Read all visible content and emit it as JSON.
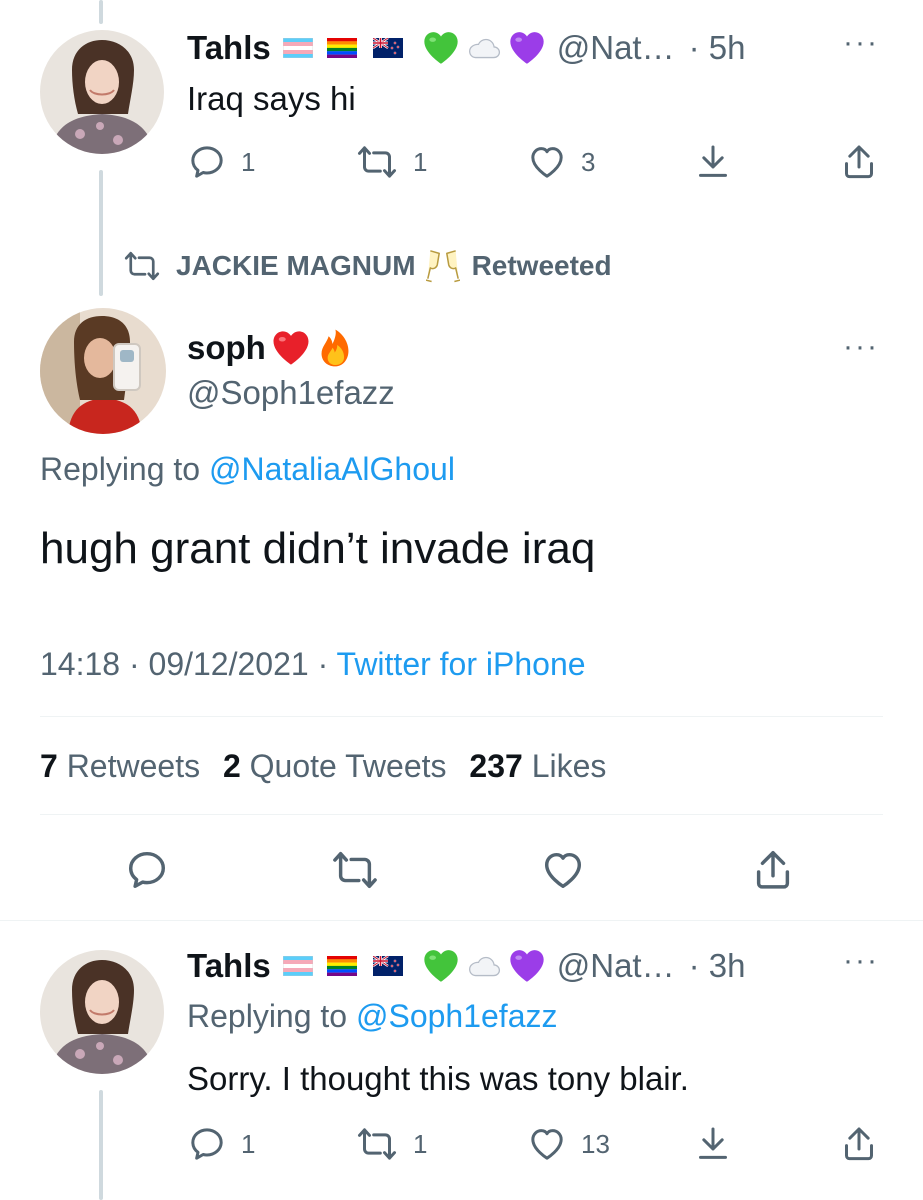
{
  "tweet1": {
    "name": "Tahls",
    "handle": "@Nat…",
    "time": "· 5h",
    "text": "Iraq says hi",
    "replies": "1",
    "retweets": "1",
    "likes": "3"
  },
  "retweet_banner": {
    "who": "JACKIE MAGNUM",
    "label": "Retweeted"
  },
  "main": {
    "name": "soph",
    "handle": "@Soph1efazz",
    "replying_prefix": "Replying to ",
    "replying_to": "@NataliaAlGhoul",
    "text": "hugh grant didn’t invade iraq",
    "time_date": "14:18 · 09/12/2021 · ",
    "source": "Twitter for iPhone",
    "stats": {
      "retweets_count": "7",
      "retweets_label": "Retweets",
      "quotes_count": "2",
      "quotes_label": "Quote Tweets",
      "likes_count": "237",
      "likes_label": "Likes"
    }
  },
  "reply": {
    "name": "Tahls",
    "handle": "@Nat…",
    "time": "· 3h",
    "replying_prefix": "Replying to ",
    "replying_to": "@Soph1efazz",
    "text": "Sorry. I thought this was tony blair.",
    "replies": "1",
    "retweets": "1",
    "likes": "13"
  },
  "icons": {
    "reply": "reply-icon",
    "retweet": "retweet-icon",
    "like": "heart-icon",
    "download": "download-icon",
    "share": "share-icon",
    "more": "more-icon"
  },
  "colors": {
    "text": "#0f1419",
    "muted": "#536471",
    "link": "#1d9bf0",
    "divider": "#eff3f4",
    "thread": "#cfd9de"
  }
}
